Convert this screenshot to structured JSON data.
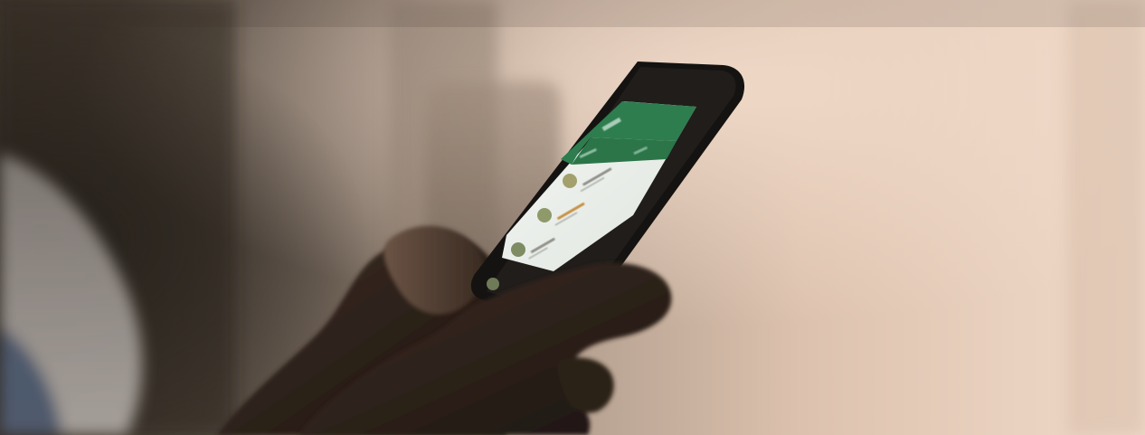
{
  "scene": {
    "subject": "hand-holding-smartphone",
    "app_theme_color": "#2e7d4f",
    "screen_background": "#eef1ee",
    "background_tone": "#e9cdb8",
    "shadow_tone": "#2a231d"
  },
  "phone_screen": {
    "header_visible": true,
    "chat_list_visible": true,
    "chat_rows": 4
  }
}
